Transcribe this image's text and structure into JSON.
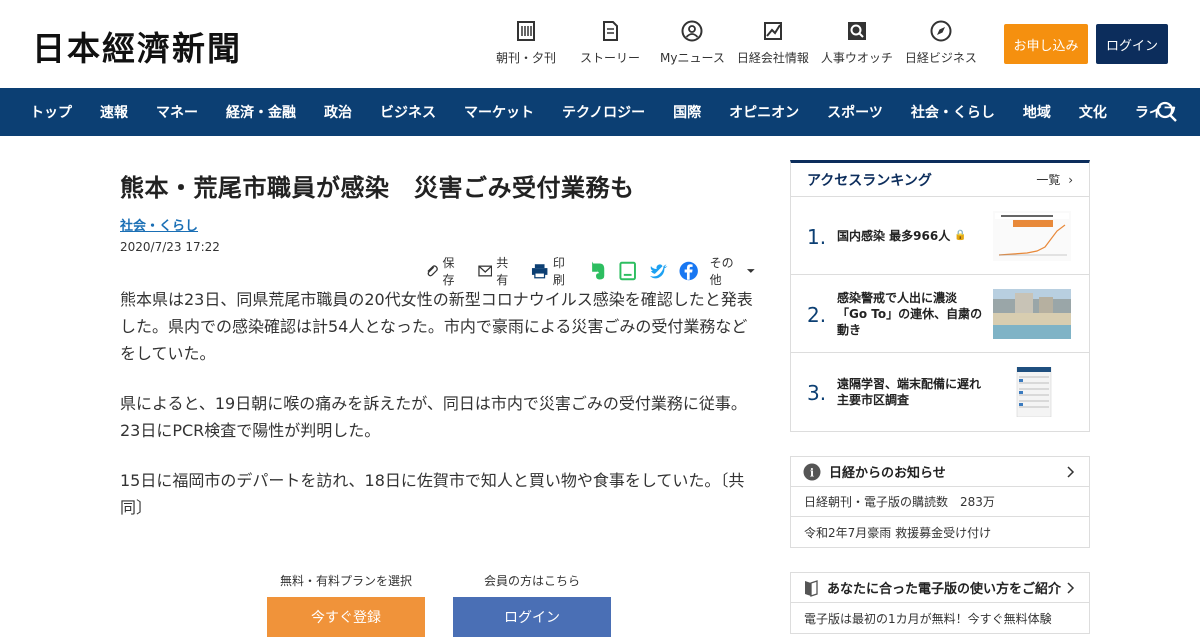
{
  "header": {
    "logo": "日本經濟新聞",
    "tools": [
      {
        "label": "朝刊・夕刊",
        "icon": "newspaper-icon"
      },
      {
        "label": "ストーリー",
        "icon": "document-icon"
      },
      {
        "label": "Myニュース",
        "icon": "user-icon"
      },
      {
        "label": "日経会社情報",
        "icon": "chart-icon"
      },
      {
        "label": "人事ウオッチ",
        "icon": "search-person-icon"
      },
      {
        "label": "日経ビジネス",
        "icon": "compass-icon"
      }
    ],
    "apply_label": "お申し込み",
    "login_label": "ログイン"
  },
  "nav": {
    "items": [
      "トップ",
      "速報",
      "マネー",
      "経済・金融",
      "政治",
      "ビジネス",
      "マーケット",
      "テクノロジー",
      "国際",
      "オピニオン",
      "スポーツ",
      "社会・くらし",
      "地域",
      "文化",
      "ライフ"
    ]
  },
  "article": {
    "title": "熊本・荒尾市職員が感染　災害ごみ受付業務も",
    "category": "社会・くらし",
    "date": "2020/7/23 17:22",
    "share": {
      "save": "保存",
      "share": "共有",
      "print": "印刷",
      "more": "その他"
    },
    "paragraphs": [
      "熊本県は23日、同県荒尾市職員の20代女性の新型コロナウイルス感染を確認したと発表した。県内での感染確認は計54人となった。市内で豪雨による災害ごみの受付業務などをしていた。",
      "県によると、19日朝に喉の痛みを訴えたが、同日は市内で災害ごみの受付業務に従事。23日にPCR検査で陽性が判明した。",
      "15日に福岡市のデパートを訪れ、18日に佐賀市で知人と買い物や食事をしていた。〔共同〕"
    ]
  },
  "paywall": {
    "register_caption": "無料・有料プランを選択",
    "register_label": "今すぐ登録",
    "login_caption": "会員の方はこちら",
    "login_label": "ログイン"
  },
  "ranking": {
    "title": "アクセスランキング",
    "more": "一覧",
    "items": [
      {
        "rank": "1.",
        "text": "国内感染 最多966人"
      },
      {
        "rank": "2.",
        "text": "感染警戒で人出に濃淡「Go To」の連休、自粛の動き"
      },
      {
        "rank": "3.",
        "text": "遠隔学習、端末配備に遅れ 主要市区調査"
      }
    ]
  },
  "notice": {
    "title": "日経からのお知らせ",
    "rows": [
      "日経朝刊・電子版の購読数　283万",
      "令和2年7月豪雨 救援募金受け付け"
    ]
  },
  "guide": {
    "title": "あなたに合った電子版の使い方をご紹介",
    "rows": [
      "電子版は最初の1カ月が無料！今すぐ無料体験"
    ]
  },
  "colors": {
    "nav_bg": "#0c3f73",
    "brand_navy": "#0c2d5c",
    "accent_orange": "#f5900f",
    "link_blue": "#1a6fb5",
    "login_blue": "#4a6fb5"
  }
}
